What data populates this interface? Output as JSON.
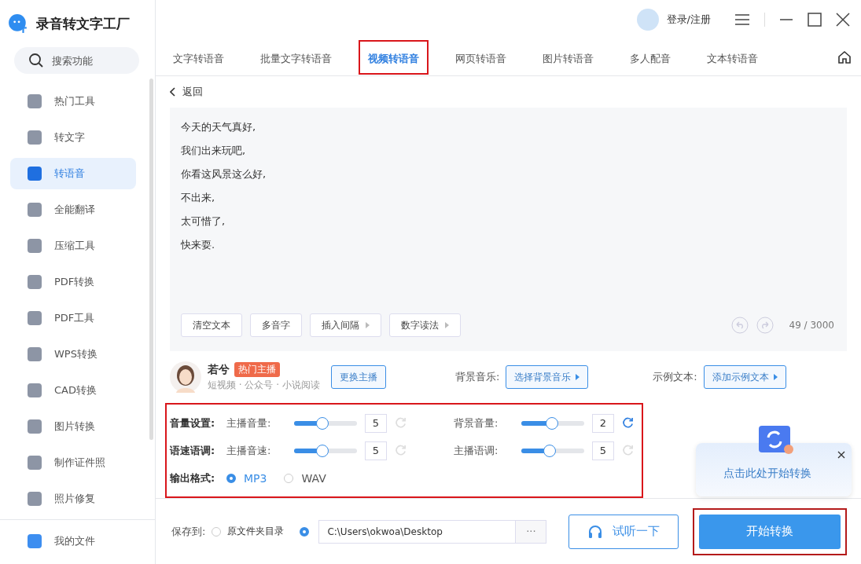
{
  "app": {
    "title": "录音转文字工厂",
    "login": "登录/注册"
  },
  "search": {
    "placeholder": "搜索功能"
  },
  "sidebar": {
    "items": [
      {
        "label": "热门工具",
        "selected": false
      },
      {
        "label": "转文字",
        "selected": false
      },
      {
        "label": "转语音",
        "selected": true
      },
      {
        "label": "全能翻译",
        "selected": false
      },
      {
        "label": "压缩工具",
        "selected": false
      },
      {
        "label": "PDF转换",
        "selected": false
      },
      {
        "label": "PDF工具",
        "selected": false
      },
      {
        "label": "WPS转换",
        "selected": false
      },
      {
        "label": "CAD转换",
        "selected": false
      },
      {
        "label": "图片转换",
        "selected": false
      },
      {
        "label": "制作证件照",
        "selected": false
      },
      {
        "label": "照片修复",
        "selected": false
      }
    ],
    "footer": "我的文件"
  },
  "tabs": [
    {
      "label": "文字转语音",
      "selected": false,
      "highlighted": false
    },
    {
      "label": "批量文字转语音",
      "selected": false,
      "highlighted": false
    },
    {
      "label": "视频转语音",
      "selected": true,
      "highlighted": true
    },
    {
      "label": "网页转语音",
      "selected": false,
      "highlighted": false
    },
    {
      "label": "图片转语音",
      "selected": false,
      "highlighted": false
    },
    {
      "label": "多人配音",
      "selected": false,
      "highlighted": false
    },
    {
      "label": "文本转语音",
      "selected": false,
      "highlighted": false
    }
  ],
  "back": "返回",
  "editor": {
    "lines": [
      "今天的天气真好,",
      "我们出来玩吧,",
      "你看这风景这么好,",
      "不出来,",
      "太可惜了,",
      "快来耍."
    ],
    "tools": [
      {
        "label": "清空文本",
        "has_arrow": false
      },
      {
        "label": "多音字",
        "has_arrow": false
      },
      {
        "label": "插入间隔",
        "has_arrow": true
      },
      {
        "label": "数字读法",
        "has_arrow": true
      }
    ],
    "count": "49 / 3000"
  },
  "voice": {
    "name": "若兮",
    "badge": "热门主播",
    "tags": "短视频 · 公众号 · 小说阅读",
    "change": "更换主播"
  },
  "bg_music": {
    "label": "背景音乐:",
    "button": "选择背景音乐"
  },
  "sample": {
    "label": "示例文本:",
    "button": "添加示例文本"
  },
  "settings": {
    "highlighted": true,
    "rows": [
      {
        "title": "音量设置:",
        "sliders": [
          {
            "label": "主播音量:",
            "level": 0.44,
            "value": "5",
            "reset_enabled": false
          },
          {
            "label": "背景音量:",
            "level": 0.49,
            "value": "2",
            "reset_enabled": true
          }
        ]
      },
      {
        "title": "语速语调:",
        "sliders": [
          {
            "label": "主播音速:",
            "level": 0.44,
            "value": "5",
            "reset_enabled": false
          },
          {
            "label": "主播语调:",
            "level": 0.44,
            "value": "5",
            "reset_enabled": false
          }
        ]
      }
    ],
    "format": {
      "title": "输出格式:",
      "options": [
        {
          "label": "MP3",
          "selected": true
        },
        {
          "label": "WAV",
          "selected": false
        }
      ]
    }
  },
  "popup": {
    "text": "点击此处开始转换"
  },
  "save": {
    "label": "保存到:",
    "options": [
      {
        "label": "原文件夹目录",
        "selected": false
      },
      {
        "selected": true
      }
    ],
    "path": "C:\\Users\\okwoa\\Desktop",
    "browse": "···"
  },
  "preview": "试听一下",
  "start": {
    "label": "开始转换",
    "highlighted": true
  }
}
